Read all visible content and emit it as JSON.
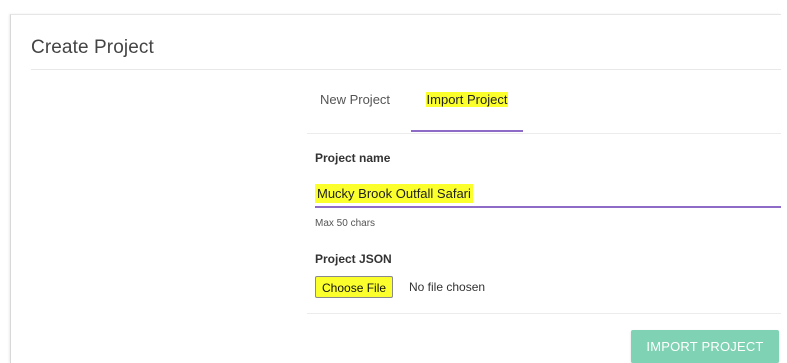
{
  "card": {
    "title": "Create Project"
  },
  "tabs": [
    {
      "label": "New Project",
      "active": false
    },
    {
      "label": "Import Project",
      "active": true
    }
  ],
  "form": {
    "name_label": "Project name",
    "name_value": "Mucky Brook Outfall Safari",
    "name_hint": "Max 50 chars",
    "json_label": "Project JSON",
    "choose_file_label": "Choose File",
    "file_status": "No file chosen",
    "submit_label": "IMPORT PROJECT"
  },
  "colors": {
    "accent": "#8d6bc7",
    "highlight": "#fbff2c",
    "submit_button": "#7fd2b3"
  }
}
